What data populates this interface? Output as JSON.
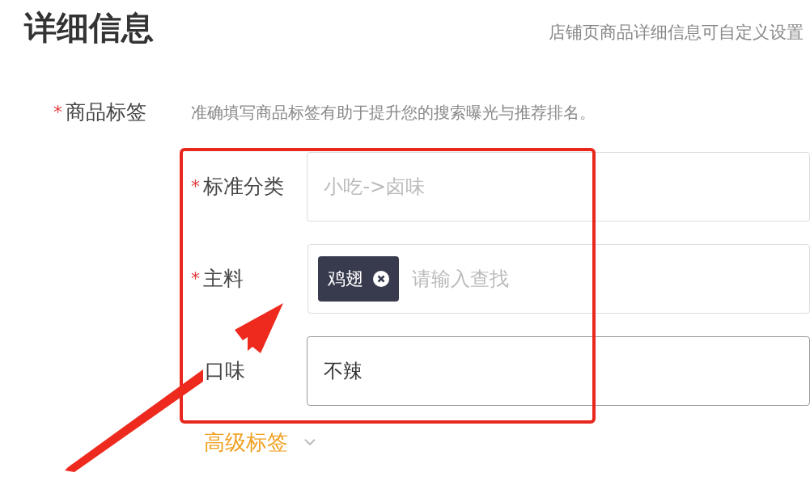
{
  "title": "详细信息",
  "subtitle": "店铺页商品详细信息可自定义设置",
  "required_mark": "*",
  "tags_field": {
    "label": "商品标签",
    "required": true,
    "hint": "准确填写商品标签有助于提升您的搜索曝光与推荐排名。"
  },
  "fields": [
    {
      "label": "标准分类",
      "required": true,
      "kind": "text",
      "placeholder": "小吃->卤味"
    },
    {
      "label": "主料",
      "required": true,
      "kind": "tags",
      "tags": [
        "鸡翅"
      ],
      "placeholder": "请输入查找"
    },
    {
      "label": "口味",
      "required": false,
      "kind": "text",
      "value": "不辣"
    }
  ],
  "advanced_toggle": {
    "label": "高级标签",
    "expanded": false
  }
}
